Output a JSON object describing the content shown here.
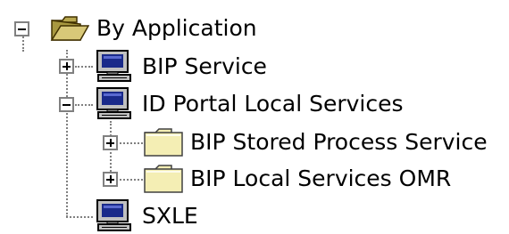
{
  "tree": {
    "root": {
      "label": "By Application",
      "icon": "open-folder-icon",
      "expanded": true
    },
    "items": [
      {
        "label": "BIP Service",
        "icon": "computer-icon",
        "expanded": false
      },
      {
        "label": "ID Portal Local Services",
        "icon": "computer-icon",
        "expanded": true,
        "children": [
          {
            "label": "BIP Stored Process Service",
            "icon": "folder-icon",
            "expanded": false
          },
          {
            "label": "BIP Local Services OMR",
            "icon": "folder-icon",
            "expanded": false
          }
        ]
      },
      {
        "label": "SXLE",
        "icon": "computer-icon",
        "expanded": null
      }
    ]
  },
  "colors": {
    "folder_open": "#d8c878",
    "folder_closed": "#f4eeb4",
    "tree_line": "#808080",
    "computer_screen": "#1a2a8a"
  }
}
